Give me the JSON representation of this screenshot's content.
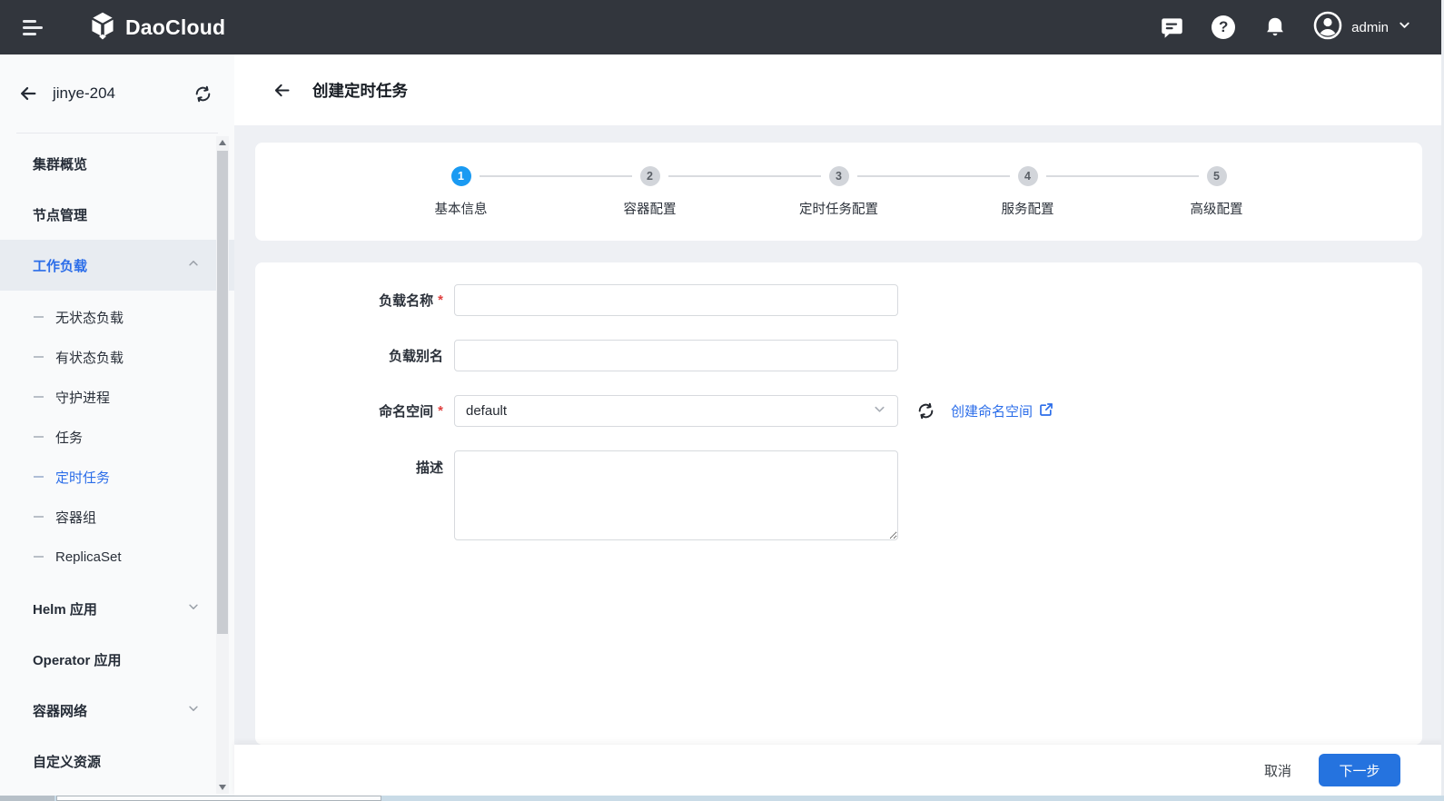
{
  "colors": {
    "navbar_bg": "#32363d",
    "accent_blue": "#2b6de9",
    "step_active_blue": "#1a9af2",
    "primary_button_blue": "#2573df",
    "required_red": "#e0403f"
  },
  "navbar": {
    "brand": "DaoCloud",
    "username": "admin"
  },
  "sidebar": {
    "cluster_name": "jinye-204",
    "items": [
      {
        "label": "集群概览"
      },
      {
        "label": "节点管理"
      },
      {
        "label": "工作负载",
        "expanded": true,
        "active": true
      },
      {
        "label": "Helm 应用",
        "collapsible": true
      },
      {
        "label": "Operator 应用"
      },
      {
        "label": "容器网络",
        "collapsible": true
      },
      {
        "label": "自定义资源"
      }
    ],
    "workload_children": [
      {
        "label": "无状态负载"
      },
      {
        "label": "有状态负载"
      },
      {
        "label": "守护进程"
      },
      {
        "label": "任务"
      },
      {
        "label": "定时任务",
        "active": true
      },
      {
        "label": "容器组"
      },
      {
        "label": "ReplicaSet"
      }
    ]
  },
  "page": {
    "title": "创建定时任务",
    "steps": [
      {
        "num": "1",
        "label": "基本信息",
        "active": true
      },
      {
        "num": "2",
        "label": "容器配置"
      },
      {
        "num": "3",
        "label": "定时任务配置"
      },
      {
        "num": "4",
        "label": "服务配置"
      },
      {
        "num": "5",
        "label": "高级配置"
      }
    ],
    "form": {
      "required_marker": "*",
      "name_label": "负载名称",
      "name_value": "",
      "alias_label": "负载别名",
      "alias_value": "",
      "namespace_label": "命名空间",
      "namespace_value": "default",
      "create_namespace_link": "创建命名空间",
      "description_label": "描述",
      "description_value": ""
    },
    "footer": {
      "cancel": "取消",
      "next": "下一步"
    }
  }
}
